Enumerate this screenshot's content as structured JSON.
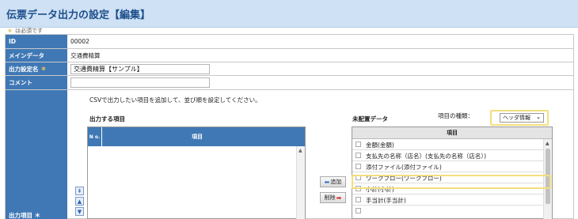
{
  "page": {
    "title": "伝票データ出力の設定【編集】"
  },
  "required_note": {
    "mark": "＊",
    "text": "は必須です"
  },
  "form": {
    "id": {
      "label": "ID",
      "value": "00002"
    },
    "main_data": {
      "label": "メインデータ",
      "value": "交通費精算"
    },
    "output_name": {
      "label": "出力設定名",
      "required_mark": "＊",
      "value": "交通費精算【サンプル】"
    },
    "comment": {
      "label": "コメント",
      "value": ""
    },
    "output_items_label": "出力項目 ＊"
  },
  "instruction": "CSVで出力したい項目を追加して、並び順を設定してください。",
  "output_items": {
    "heading": "出力する項目",
    "col_no": "N o.",
    "col_item": "項目",
    "rows": []
  },
  "move_buttons": {
    "top_icon": "move-top-icon",
    "up_icon": "move-up-icon",
    "down_icon": "move-down-icon"
  },
  "buttons": {
    "add_label": "追加",
    "remove_label": "削除"
  },
  "unplaced": {
    "heading": "未配置データ",
    "type_label": "項目の種類：",
    "type_selected": "ヘッダ情報",
    "col_item": "項目",
    "items": [
      "金額(金額)",
      "支払先の名称（店名）(支払先の名称（店名）)",
      "添付ファイル(添付ファイル)",
      "ワークフロー(ワークフロー)",
      "小計(小計)",
      "手当計(手当計)"
    ]
  },
  "colors": {
    "header_blue": "#3f78b5",
    "title_bg": "#cfe1f4",
    "title_text": "#1d4f8c",
    "required": "#d9a400",
    "highlight": "#f3df7e"
  }
}
